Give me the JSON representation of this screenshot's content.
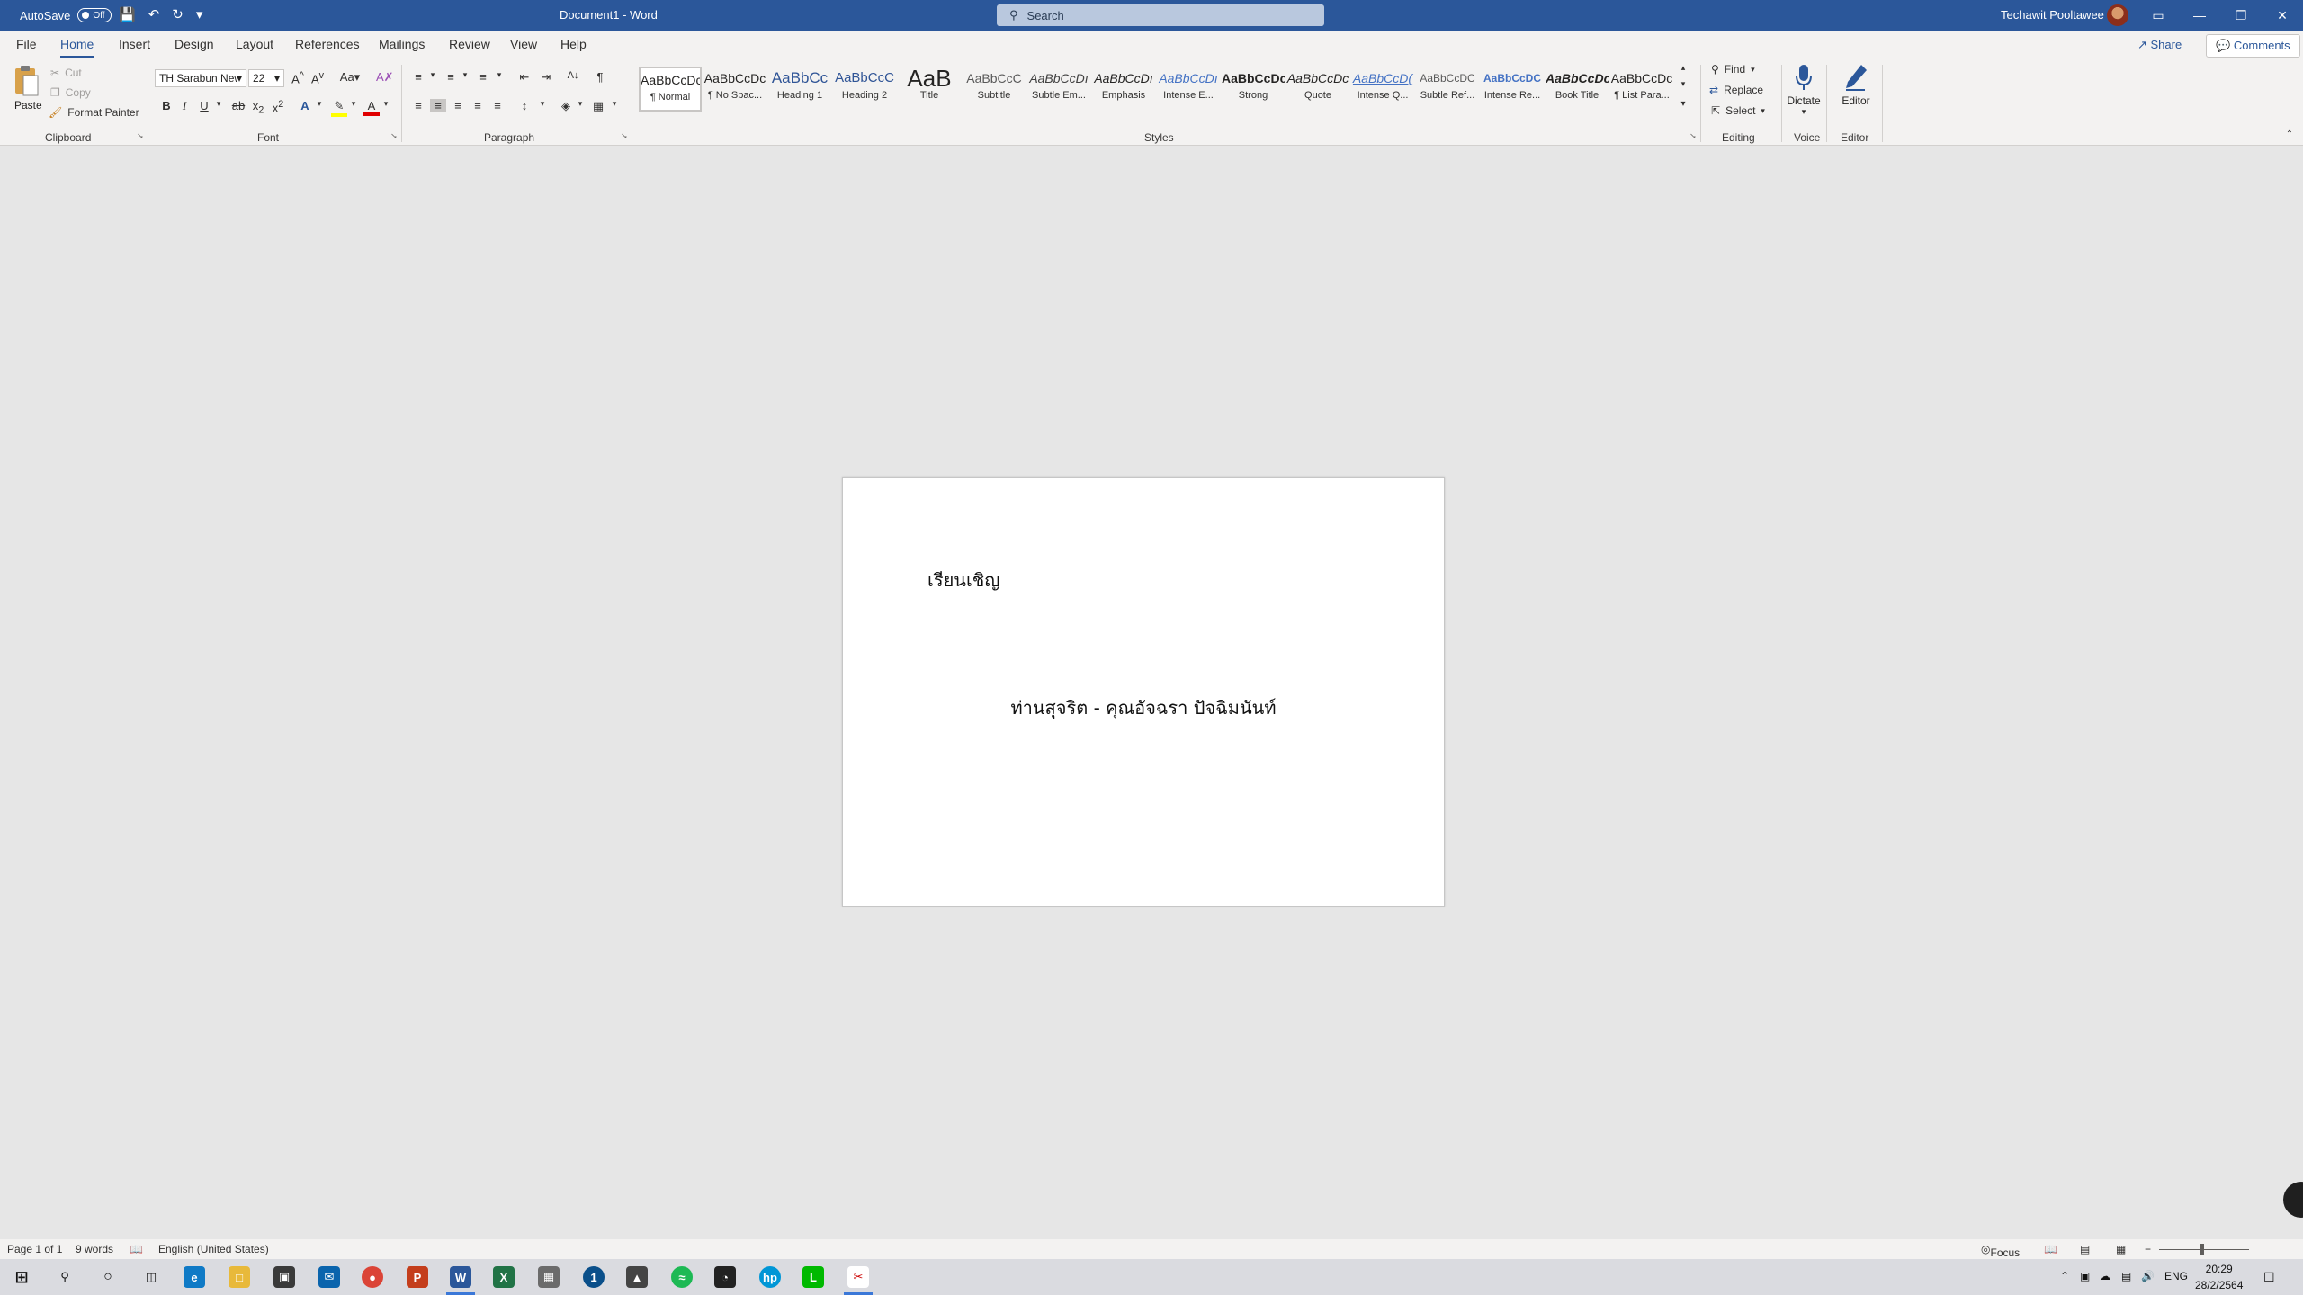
{
  "titlebar": {
    "autosave_label": "AutoSave",
    "autosave_state": "Off",
    "doc_title": "Document1  -  Word",
    "search_placeholder": "Search",
    "user_name": "Techawit Pooltawee"
  },
  "tabs": [
    "File",
    "Home",
    "Insert",
    "Design",
    "Layout",
    "References",
    "Mailings",
    "Review",
    "View",
    "Help"
  ],
  "share_label": "Share",
  "comments_label": "Comments",
  "ribbon": {
    "clipboard": {
      "paste": "Paste",
      "cut": "Cut",
      "copy": "Copy",
      "format_painter": "Format Painter",
      "label": "Clipboard"
    },
    "font": {
      "name": "TH Sarabun New",
      "size": "22",
      "label": "Font"
    },
    "paragraph": {
      "label": "Paragraph"
    },
    "styles": {
      "label": "Styles",
      "items": [
        {
          "preview": "AaBbCcDc",
          "name": "¶ Normal"
        },
        {
          "preview": "AaBbCcDc",
          "name": "¶ No Spac..."
        },
        {
          "preview": "AaBbCc",
          "name": "Heading 1"
        },
        {
          "preview": "AaBbCcC",
          "name": "Heading 2"
        },
        {
          "preview": "AaB",
          "name": "Title"
        },
        {
          "preview": "AaBbCcC",
          "name": "Subtitle"
        },
        {
          "preview": "AaBbCcDı",
          "name": "Subtle Em..."
        },
        {
          "preview": "AaBbCcDı",
          "name": "Emphasis"
        },
        {
          "preview": "AaBbCcDı",
          "name": "Intense E..."
        },
        {
          "preview": "AaBbCcDc",
          "name": "Strong"
        },
        {
          "preview": "AaBbCcDc",
          "name": "Quote"
        },
        {
          "preview": "AaBbCcD(",
          "name": "Intense Q..."
        },
        {
          "preview": "AaBbCcDC",
          "name": "Subtle Ref..."
        },
        {
          "preview": "AaBbCcDC",
          "name": "Intense Re..."
        },
        {
          "preview": "AaBbCcDc",
          "name": "Book Title"
        },
        {
          "preview": "AaBbCcDc",
          "name": "¶ List Para..."
        }
      ]
    },
    "editing": {
      "find": "Find",
      "replace": "Replace",
      "select": "Select",
      "label": "Editing"
    },
    "voice": {
      "dictate": "Dictate",
      "label": "Voice"
    },
    "editor": {
      "editor": "Editor",
      "label": "Editor"
    }
  },
  "document": {
    "line1": "เรียนเชิญ",
    "line2": "ท่านสุจริต - คุณอัจฉรา ปัจฉิมนันท์"
  },
  "statusbar": {
    "page": "Page 1 of 1",
    "words": "9 words",
    "language": "English (United States)",
    "focus": "Focus"
  },
  "taskbar": {
    "lang": "ENG",
    "time": "20:29",
    "date": "28/2/2564"
  },
  "colors": {
    "word_blue": "#2b579a",
    "ribbon_bg": "#f3f2f1",
    "canvas_bg": "#e6e6e6"
  }
}
